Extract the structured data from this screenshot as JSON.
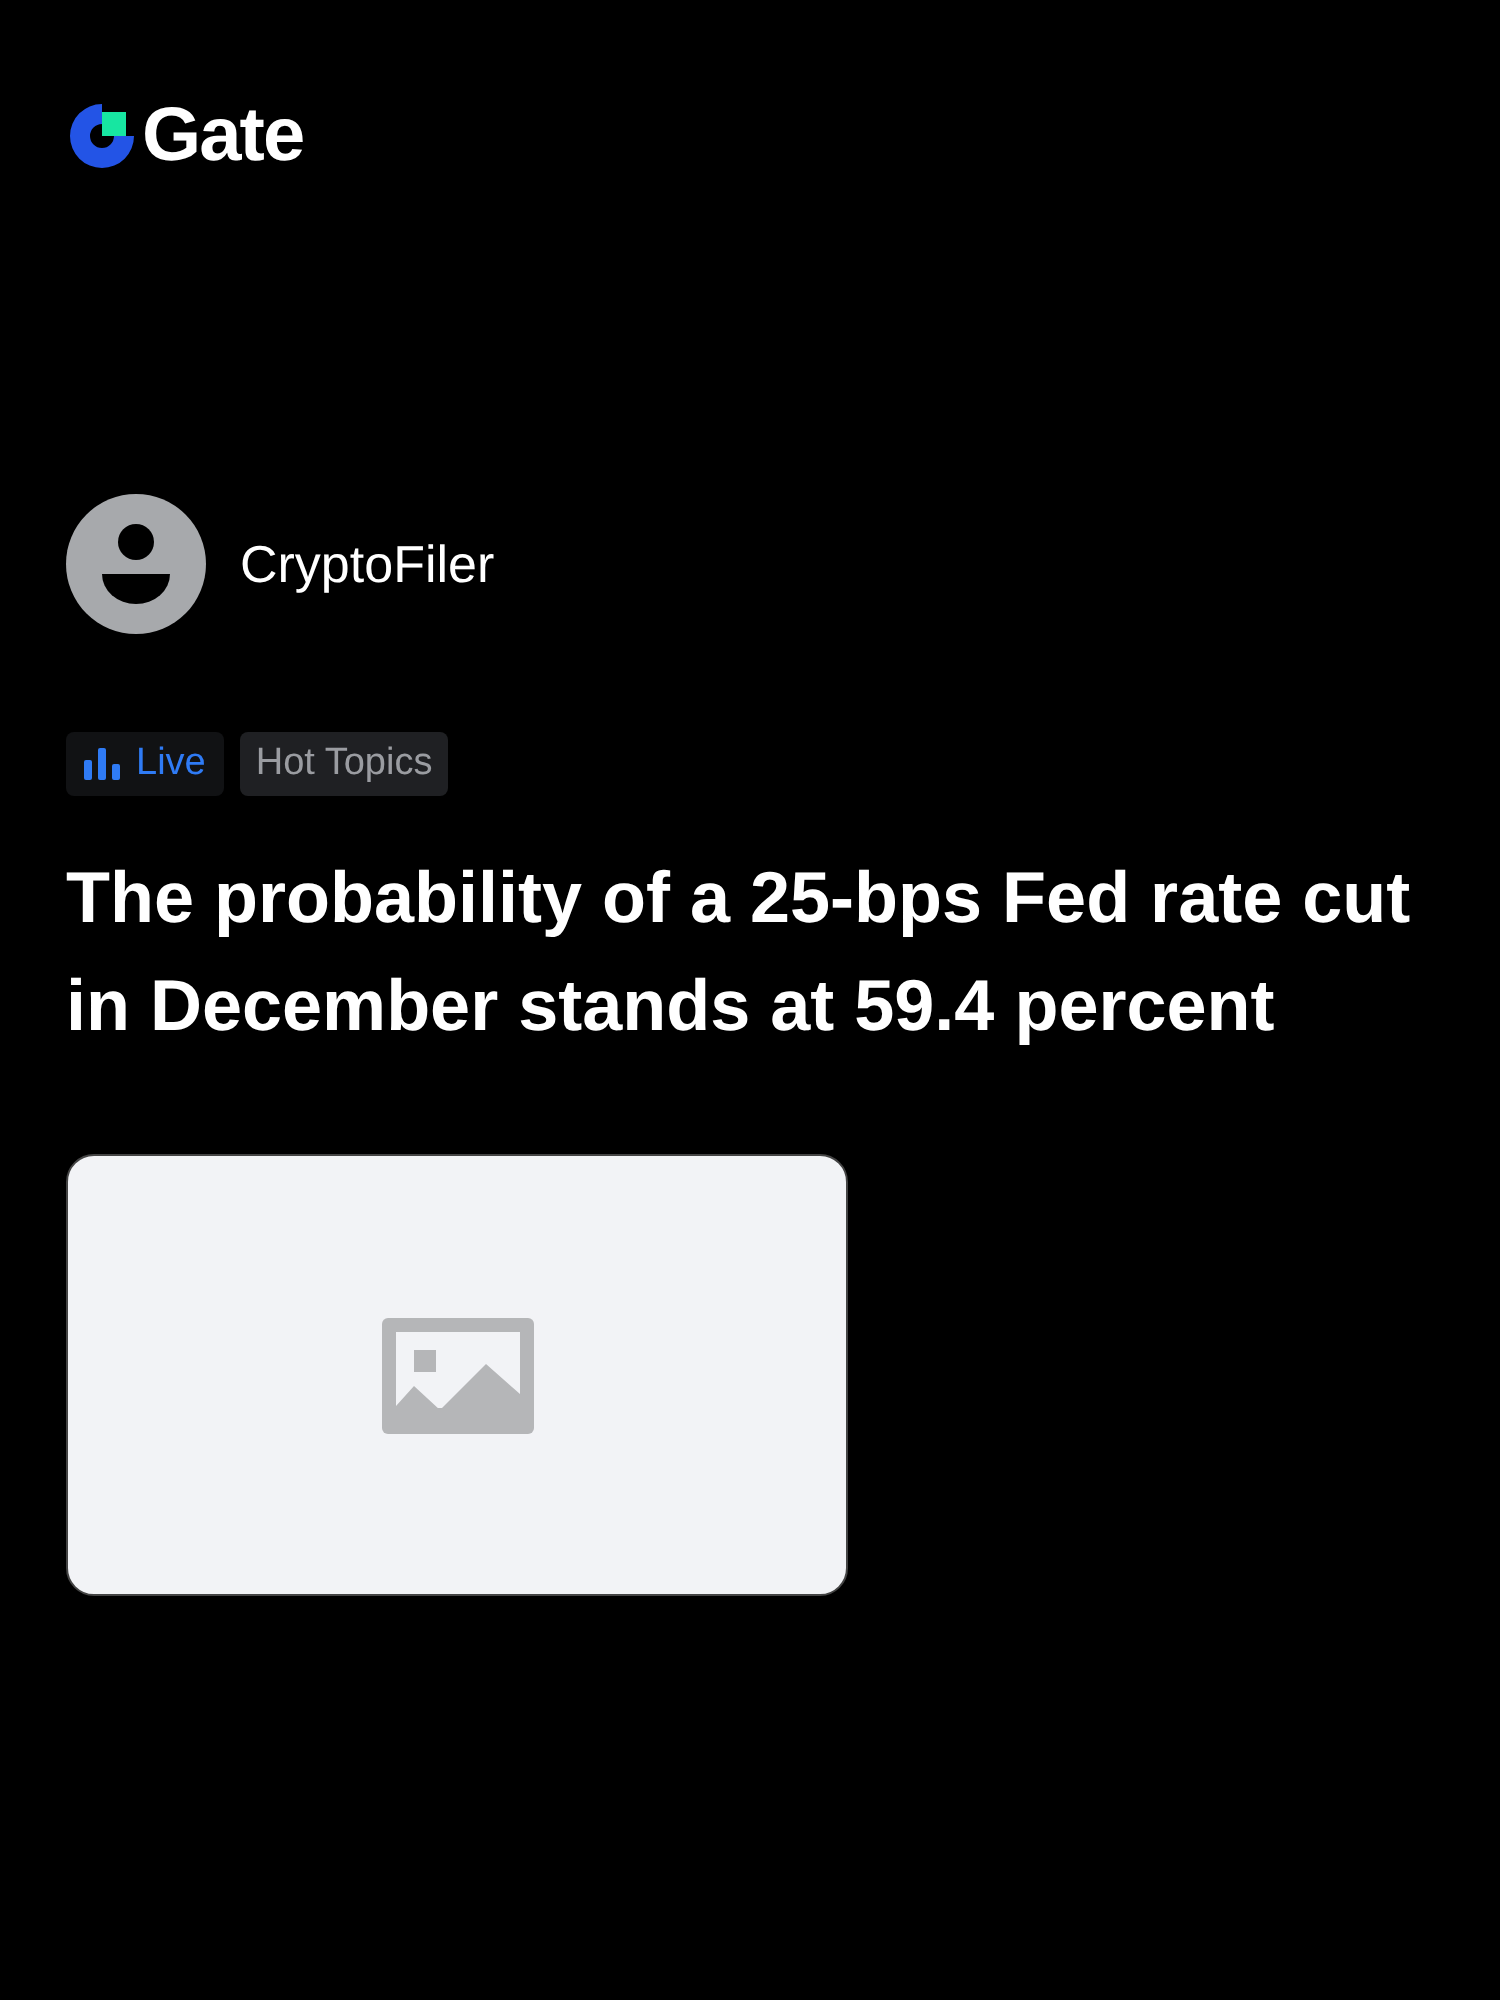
{
  "logo": {
    "text": "Gate"
  },
  "author": {
    "name": "CryptoFiler"
  },
  "tags": [
    {
      "kind": "live",
      "label": "Live"
    },
    {
      "kind": "topic",
      "label": "Hot Topics"
    }
  ],
  "headline": "The probability of a 25-bps Fed rate cut in December stands at 59.4 percent",
  "image": {
    "kind": "placeholder"
  }
}
